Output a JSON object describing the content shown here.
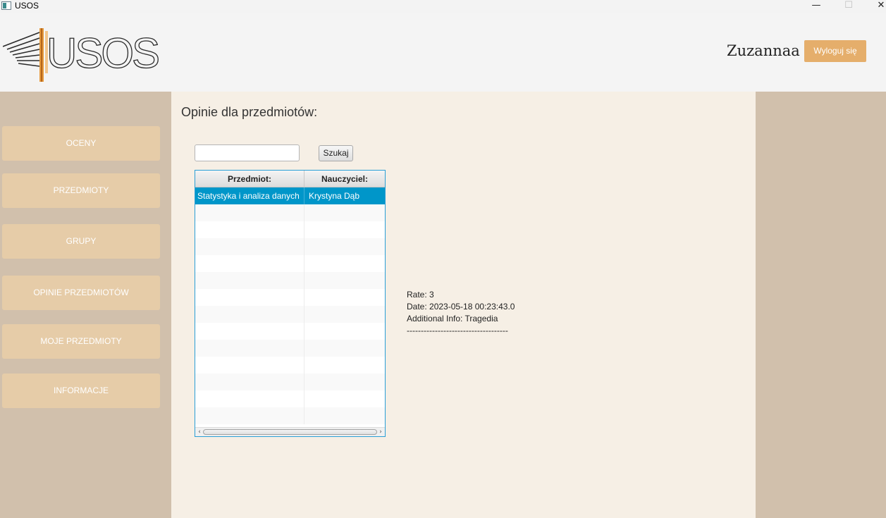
{
  "window": {
    "title": "USOS",
    "minimize_glyph": "—",
    "maximize_glyph": "☐",
    "close_glyph": "✕"
  },
  "header": {
    "logo_text": "USOS",
    "username": "Zuzannaa",
    "logout_label": "Wyloguj się"
  },
  "sidebar": {
    "items": [
      {
        "label": "OCENY"
      },
      {
        "label": "PRZEDMIOTY"
      },
      {
        "label": "GRUPY"
      },
      {
        "label": "OPINIE PRZEDMIOTÓW"
      },
      {
        "label": "MOJE PRZEDMIOTY"
      },
      {
        "label": "INFORMACJE"
      }
    ]
  },
  "main": {
    "title": "Opinie dla przedmiotów:",
    "search": {
      "value": "",
      "placeholder": ""
    },
    "search_button": "Szukaj",
    "table": {
      "columns": [
        "Przedmiot:",
        "Nauczyciel:"
      ],
      "rows": [
        {
          "subject": "Statystyka i analiza danych",
          "teacher": "Krystyna Dąb",
          "selected": true
        }
      ]
    },
    "opinion": {
      "rate": "Rate: 3",
      "date": "Date: 2023-05-18 00:23:43.0",
      "info": "Additional Info: Tragedia",
      "separator": "------------------------------------"
    }
  },
  "colors": {
    "accent_button": "#e5ae6b",
    "sidebar_bg": "#d1c0ac",
    "nav_button": "#e6cca8",
    "main_bg": "#f6efe5",
    "selection": "#0096c9"
  }
}
